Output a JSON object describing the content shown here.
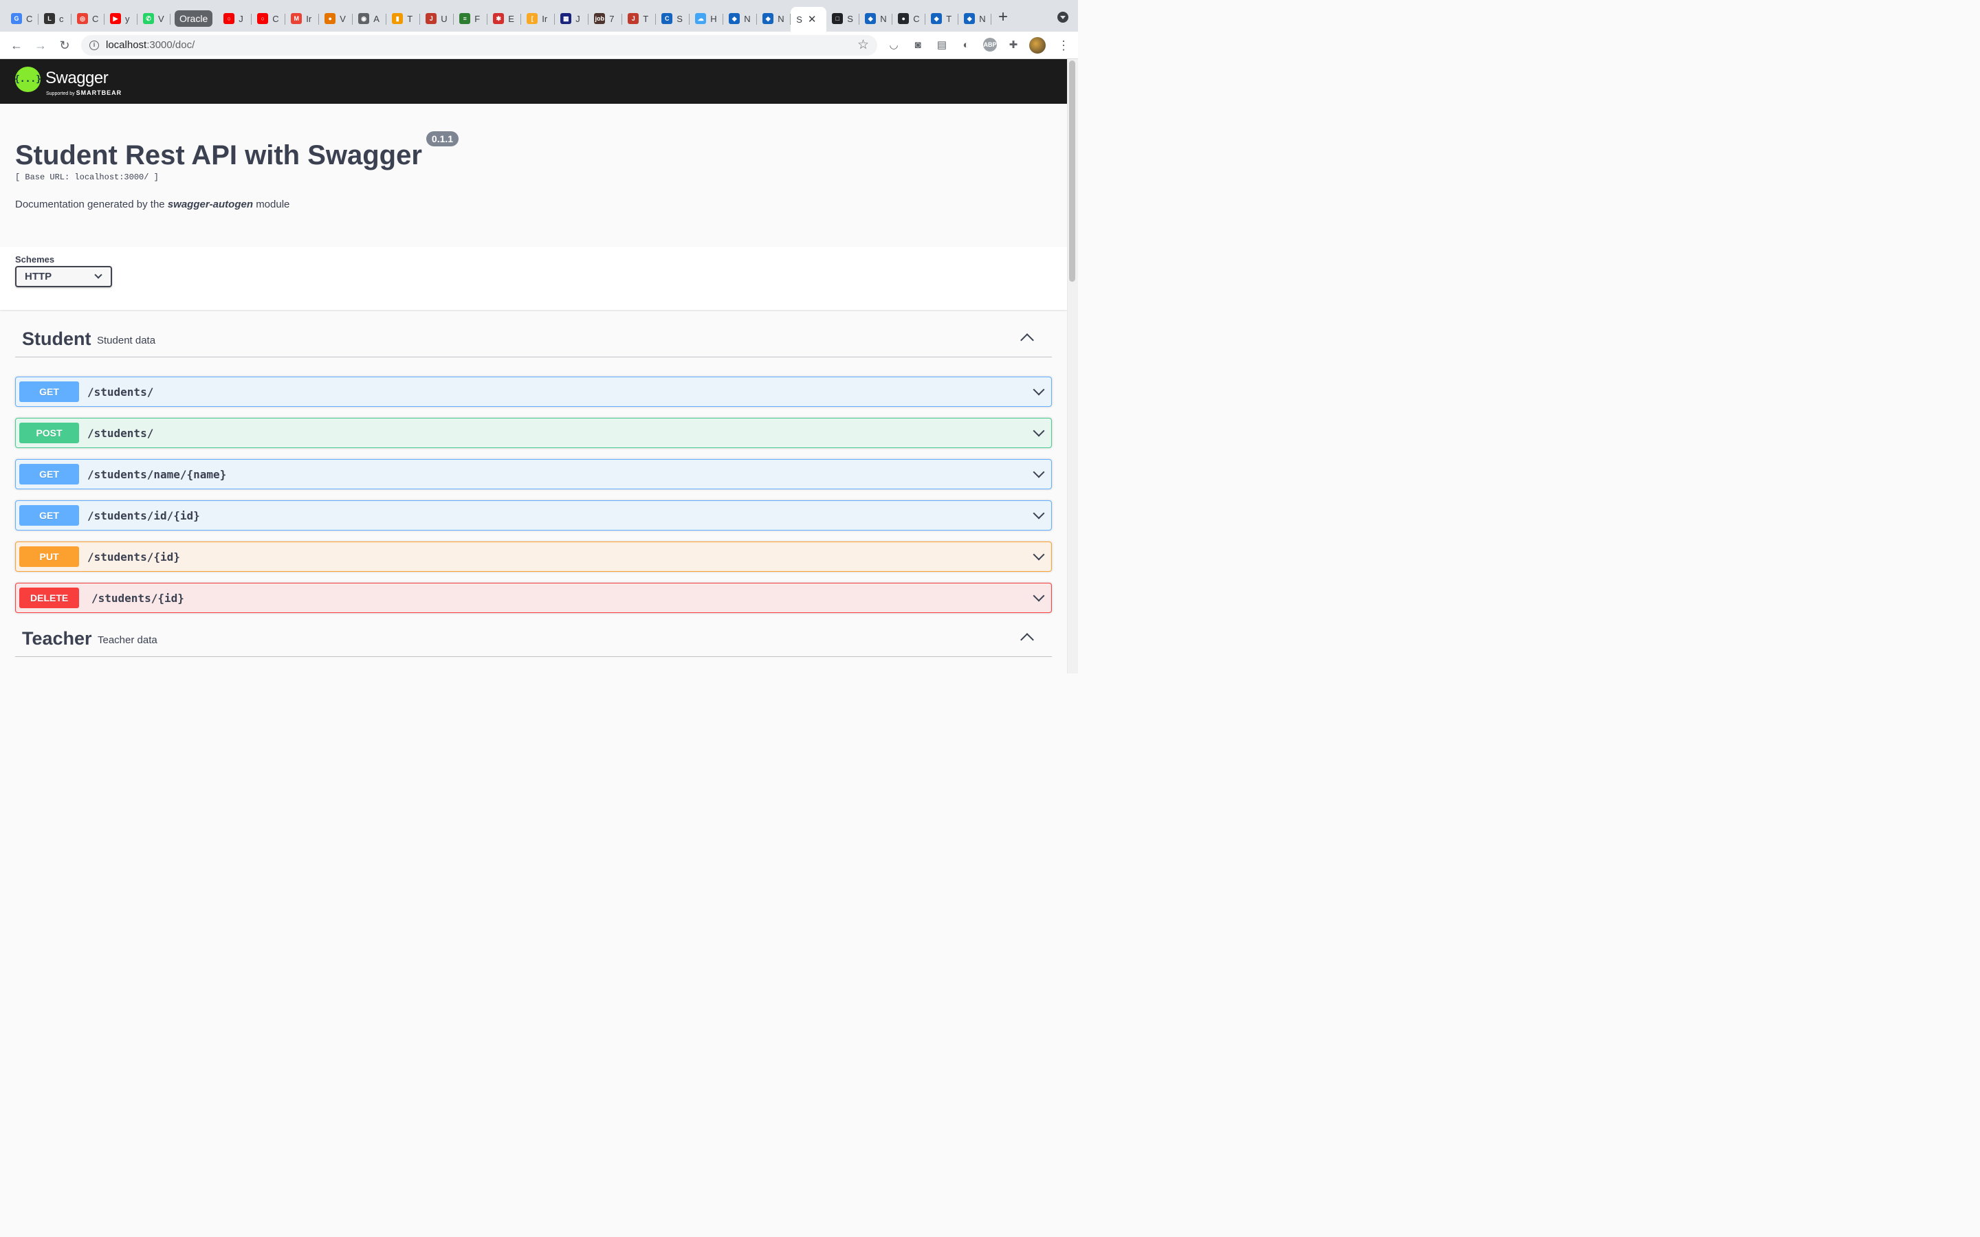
{
  "browser": {
    "tabs": [
      {
        "icon": "google-translate-icon",
        "letter": "G",
        "color": "#4285f4",
        "label": "C"
      },
      {
        "icon": "latex-icon",
        "letter": "L",
        "color": "#333333",
        "label": "c"
      },
      {
        "icon": "circle-app-icon",
        "letter": "◎",
        "color": "#e94235",
        "label": "C"
      },
      {
        "icon": "youtube-icon",
        "letter": "▶",
        "color": "#ff0000",
        "label": "y"
      },
      {
        "icon": "whatsapp-icon",
        "letter": "✆",
        "color": "#25d366",
        "label": "V"
      }
    ],
    "tab_group_label": "Oracle",
    "group_tabs": [
      {
        "icon": "oracle-icon",
        "letter": "○",
        "color": "#f80000",
        "label": "J"
      },
      {
        "icon": "oracle-icon",
        "letter": "○",
        "color": "#f80000",
        "label": "C"
      },
      {
        "icon": "gmail-icon",
        "letter": "M",
        "color": "#ea4335",
        "label": "Ir"
      },
      {
        "icon": "contacts-icon",
        "letter": "●",
        "color": "#e37400",
        "label": "V"
      },
      {
        "icon": "globe-icon",
        "letter": "◉",
        "color": "#5f6368",
        "label": "A"
      },
      {
        "icon": "bookmark-icon",
        "letter": "▮",
        "color": "#f29900",
        "label": "T"
      },
      {
        "icon": "java-icon",
        "letter": "J",
        "color": "#c0392b",
        "label": "U"
      },
      {
        "icon": "document-icon",
        "letter": "≡",
        "color": "#2e7d32",
        "label": "F"
      },
      {
        "icon": "squid-icon",
        "letter": "✱",
        "color": "#d32f2f",
        "label": "E"
      },
      {
        "icon": "bracket-icon",
        "letter": "[",
        "color": "#f9a825",
        "label": "Ir"
      },
      {
        "icon": "bank-icon",
        "letter": "▦",
        "color": "#1a237e",
        "label": "J"
      },
      {
        "icon": "job-icon",
        "letter": "job",
        "color": "#4e342e",
        "label": "7"
      },
      {
        "icon": "java-icon",
        "letter": "J",
        "color": "#c0392b",
        "label": "T"
      },
      {
        "icon": "c-circle-icon",
        "letter": "C",
        "color": "#1565c0",
        "label": "S"
      },
      {
        "icon": "cloud-icon",
        "letter": "☁",
        "color": "#42a5f5",
        "label": "H"
      },
      {
        "icon": "cube-icon",
        "letter": "◆",
        "color": "#1565c0",
        "label": "N"
      },
      {
        "icon": "cube-icon",
        "letter": "◆",
        "color": "#1565c0",
        "label": "N"
      }
    ],
    "active_tab": {
      "letter": "S",
      "label": "S",
      "close": "✕"
    },
    "after_tabs": [
      {
        "icon": "square-icon",
        "letter": "□",
        "color": "#202124",
        "label": "S"
      },
      {
        "icon": "cube-icon",
        "letter": "◆",
        "color": "#1565c0",
        "label": "N"
      },
      {
        "icon": "github-icon",
        "letter": "●",
        "color": "#24292e",
        "label": "C"
      },
      {
        "icon": "cube-icon",
        "letter": "◆",
        "color": "#1565c0",
        "label": "T"
      },
      {
        "icon": "cube-icon",
        "letter": "◆",
        "color": "#1565c0",
        "label": "N"
      }
    ],
    "new_tab": "+",
    "url_host": "localhost",
    "url_path": ":3000/doc/"
  },
  "swagger": {
    "logo_text": "Swagger",
    "logo_glyph": "{...}",
    "supported_by": "Supported by",
    "company": "SMARTBEAR",
    "title": "Student Rest API with Swagger",
    "version": "0.1.1",
    "base_url": "[ Base URL: localhost:3000/ ]",
    "desc_prefix": "Documentation generated by the",
    "desc_module": "swagger-autogen",
    "desc_suffix": "module",
    "schemes_label": "Schemes",
    "scheme_selected": "HTTP"
  },
  "tags": [
    {
      "name": "Student",
      "description": "Student data"
    },
    {
      "name": "Teacher",
      "description": "Teacher data"
    }
  ],
  "operations": [
    {
      "method": "GET",
      "path": "/students/"
    },
    {
      "method": "POST",
      "path": "/students/"
    },
    {
      "method": "GET",
      "path": "/students/name/{name}"
    },
    {
      "method": "GET",
      "path": "/students/id/{id}"
    },
    {
      "method": "PUT",
      "path": "/students/{id}"
    },
    {
      "method": "DELETE",
      "path": "/students/{id}"
    }
  ],
  "colors": {
    "get": "#61affe",
    "post": "#49cc90",
    "put": "#fca130",
    "delete": "#f93e3e",
    "swagger_green": "#85ea2d",
    "topbar": "#1b1b1b"
  }
}
